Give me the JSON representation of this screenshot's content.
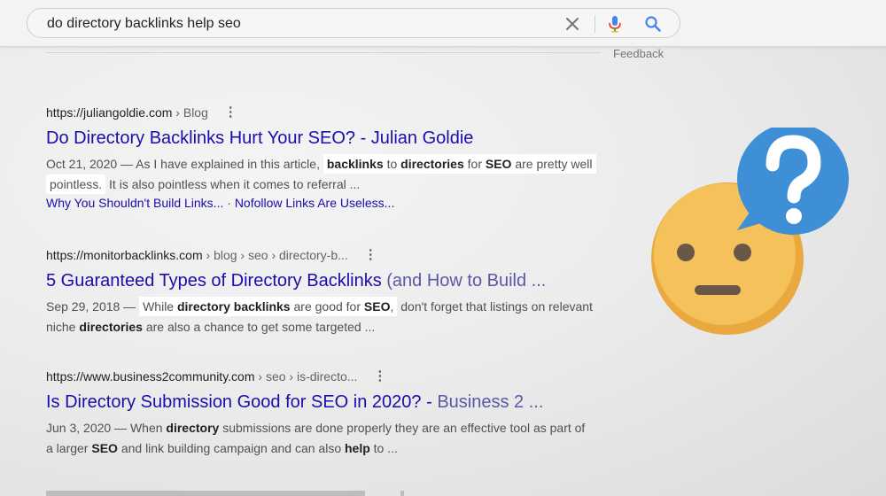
{
  "search": {
    "query": "do directory backlinks help seo"
  },
  "feedback_label": "Feedback",
  "results": [
    {
      "site": "https://juliangoldie.com",
      "path": " › Blog",
      "title": "Do Directory Backlinks Hurt Your SEO? - Julian Goldie",
      "date": "Oct 21, 2020",
      "s1": " — As I have explained in this article, ",
      "s2": "backlinks",
      "s3": " to ",
      "s4": "directories",
      "s5": " for ",
      "s6": "SEO",
      "s7": " are pretty well",
      "s8": "pointless.",
      "s9": " It is also pointless when it comes to referral ...",
      "sitelink1": "Why You Shouldn't Build Links...",
      "sitelink_sep": " · ",
      "sitelink2": "Nofollow Links Are Useless..."
    },
    {
      "site": "https://monitorbacklinks.com",
      "path": " › blog › seo › directory-b...",
      "title_main": "5 Guaranteed Types of Directory Backlinks",
      "title_fade": " (and How to Build ...",
      "date": "Sep 29, 2018",
      "s1": " — ",
      "s2": "While ",
      "s3": "directory backlinks",
      "s4": " are good for ",
      "s5": "SEO",
      "s6": ",",
      "s7": " don't forget that listings on relevant",
      "s8": "niche ",
      "s9": "directories",
      "s10": " are also a chance to get some targeted ..."
    },
    {
      "site": "https://www.business2community.com",
      "path": " › seo › is-directo...",
      "title_main": "Is Directory Submission Good for SEO in 2020? - ",
      "title_fade": "Business 2 ...",
      "date": "Jun 3, 2020",
      "s1": " — When ",
      "s2": "directory",
      "s3": " submissions are done properly they are an effective tool as part of",
      "s4": "a larger ",
      "s5": "SEO",
      "s6": " and link building campaign and can also ",
      "s7": "help",
      "s8": " to ..."
    }
  ],
  "colors": {
    "link": "#1a0dab",
    "emoji_face": "#f1b84f",
    "bubble": "#3f8fd6"
  },
  "icons": [
    "clear-icon",
    "mic-icon",
    "search-icon",
    "more-vert-icon",
    "question-bubble-icon",
    "neutral-face-icon"
  ]
}
